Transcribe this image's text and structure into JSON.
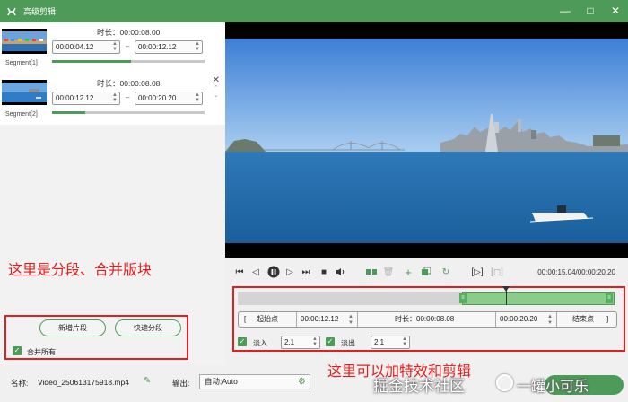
{
  "window": {
    "title": "高级剪辑",
    "minimize": "—",
    "maximize": "□",
    "close": "✕"
  },
  "segments": [
    {
      "label": "Segment[1]",
      "duration": "时长：00:00:08.00",
      "start": "00:00:04.12",
      "end": "00:00:12.12",
      "progress": 0.52
    },
    {
      "label": "Segment[2]",
      "duration": "时长：00:00:08.08",
      "start": "00:00:12.12",
      "end": "00:00:20.20",
      "progress": 0.22
    }
  ],
  "left_panel": {
    "annotation": "这里是分段、合并版块",
    "add_segment_button": "新增片段",
    "quick_split_button": "快速分段",
    "merge_all_label": "合并所有",
    "merge_all_checked": true
  },
  "player": {
    "timecode": "00:00:15.04/00:00:20.20",
    "playhead_ratio": 0.71
  },
  "trim": {
    "start_point_label": "起始点",
    "start_time": "00:00:12.12",
    "duration_label": "时长：00:00:08.08",
    "end_time": "00:00:20.20",
    "end_point_label": "结束点",
    "fade_in_label": "淡入",
    "fade_in_value": "2.1",
    "fade_out_label": "淡出",
    "fade_out_value": "2.1",
    "annotation": "这里可以加特效和剪辑"
  },
  "bottom": {
    "name_label": "名称:",
    "file_name": "Video_250613175918.mp4",
    "output_label": "输出:",
    "output_value": "自动;Auto"
  },
  "watermark": {
    "text": "掘金技术社区",
    "suffix": "一罐小可乐"
  },
  "colors": {
    "accent": "#4e9a59",
    "annotation_red": "#e0201f"
  }
}
